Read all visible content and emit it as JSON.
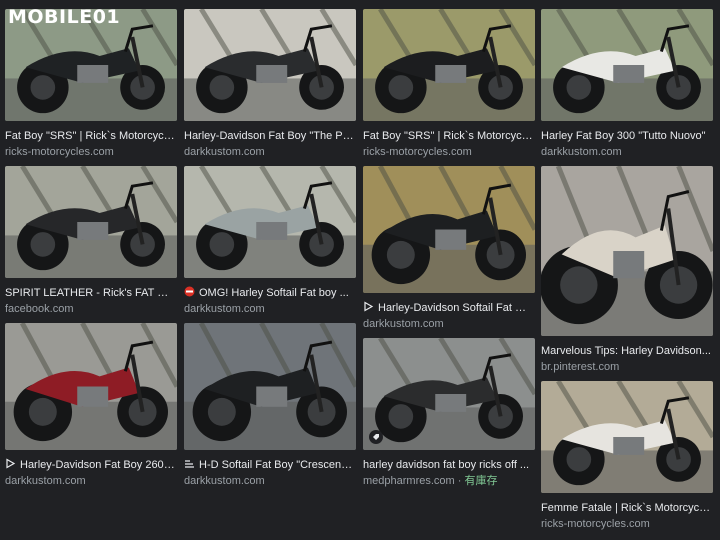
{
  "header": {
    "logo_text": "MOBILE01"
  },
  "results": [
    {
      "title": "Fat Boy \"SRS\" | Rick`s Motorcycles",
      "source": "ricks-motorcycles.com",
      "tint": "#8d9a86",
      "bike": "#1f2224"
    },
    {
      "title": "Harley-Davidson Fat Boy \"The Pu...",
      "source": "darkkustom.com",
      "tint": "#c9c7bf",
      "bike": "#2a2c2e"
    },
    {
      "title": "Fat Boy \"SRS\" | Rick`s Motorcycles",
      "source": "ricks-motorcycles.com",
      "tint": "#9b9a6a",
      "bike": "#1c1d1f"
    },
    {
      "title": "Harley Fat Boy 300 \"Tutto Nuovo\"",
      "source": "darkkustom.com",
      "tint": "#8f9a7c",
      "bike": "#e8e8e4"
    },
    {
      "title": "SPIRIT LEATHER - Rick's FAT BO...",
      "source": "facebook.com",
      "tint": "#a3a59a",
      "bike": "#262729"
    },
    {
      "title": "OMG! Harley Softail Fat boy ...",
      "source": "darkkustom.com",
      "tint": "#b5b7ad",
      "bike": "#9aa3a3",
      "prefix": "stop-icon"
    },
    {
      "title": "Harley-Davidson Softail Fat Bo...",
      "source": "darkkustom.com",
      "tint": "#a08f5a",
      "bike": "#1d1f21",
      "prefix": "play-icon"
    },
    {
      "title": "Marvelous Tips: Harley Davidson...",
      "source": "br.pinterest.com",
      "tint": "#a9a59f",
      "bike": "#d9d3c8"
    },
    {
      "title": "Harley-Davidson Fat Boy 260 \"...",
      "source": "darkkustom.com",
      "tint": "#9a9a95",
      "bike": "#8e1c25",
      "prefix": "play-icon"
    },
    {
      "title": "H-D Softail Fat Boy \"Crescend...",
      "source": "darkkustom.com",
      "tint": "#6f7479",
      "bike": "#1e2022",
      "prefix": "wave-icon"
    },
    {
      "title": "harley davidson fat boy ricks off ...",
      "source": "medpharmres.com",
      "stock": "有庫存",
      "tint": "#8c8f8e",
      "bike": "#2b2c2d",
      "tag": true
    },
    {
      "title": "Femme Fatale | Rick`s Motorcycles",
      "source": "ricks-motorcycles.com",
      "tint": "#b3ab97",
      "bike": "#e6e4df"
    }
  ],
  "stock_separator": " · "
}
